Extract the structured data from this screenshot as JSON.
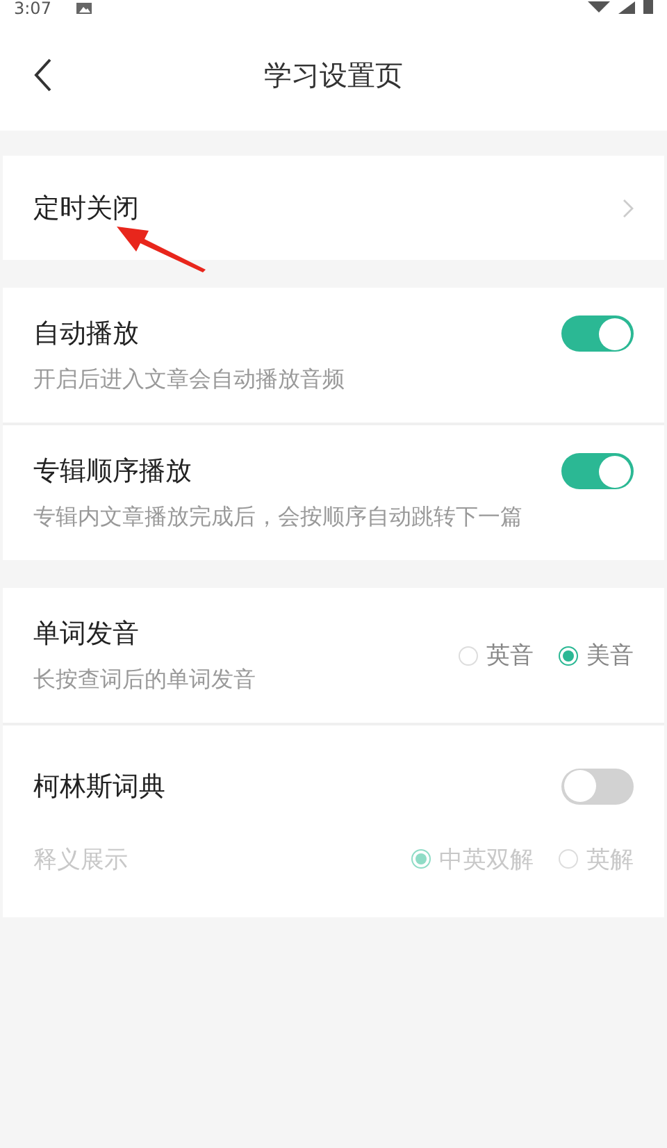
{
  "status_bar": {
    "time": "3:07"
  },
  "header": {
    "title": "学习设置页"
  },
  "sections": [
    {
      "rows": [
        {
          "kind": "link",
          "title": "定时关闭"
        }
      ]
    },
    {
      "rows": [
        {
          "kind": "toggle",
          "title": "自动播放",
          "subtitle": "开启后进入文章会自动播放音频",
          "on": true
        },
        {
          "kind": "toggle",
          "title": "专辑顺序播放",
          "subtitle": "专辑内文章播放完成后，会按顺序自动跳转下一篇",
          "on": true
        }
      ]
    },
    {
      "rows": [
        {
          "kind": "radio",
          "title": "单词发音",
          "subtitle": "长按查词后的单词发音",
          "options": [
            {
              "label": "英音",
              "selected": false
            },
            {
              "label": "美音",
              "selected": true
            }
          ]
        },
        {
          "kind": "toggle",
          "title": "柯林斯词典",
          "on": false,
          "detail": {
            "label": "释义展示",
            "disabled": true,
            "options": [
              {
                "label": "中英双解",
                "selected": true
              },
              {
                "label": "英解",
                "selected": false
              }
            ]
          }
        }
      ]
    }
  ]
}
